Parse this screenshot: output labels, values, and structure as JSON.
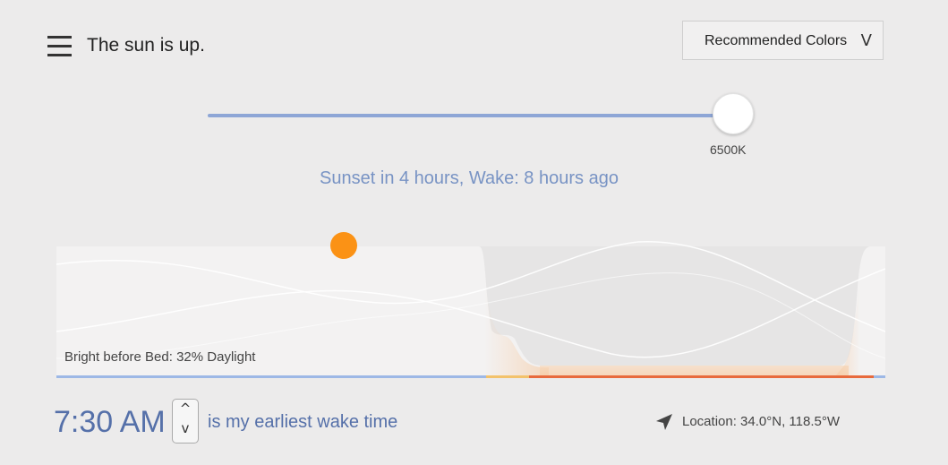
{
  "header": {
    "status": "The sun is up.",
    "menu_icon": "hamburger-menu-icon"
  },
  "color_dropdown": {
    "selected": "Recommended Colors",
    "chevron": "V"
  },
  "temperature_slider": {
    "value_label": "6500K",
    "position_fraction": 0.96,
    "accent": "#8ea6d6"
  },
  "info": {
    "text": "Sunset in 4 hours, Wake: 8 hours ago"
  },
  "chart_panel": {
    "bright_label": "Bright before Bed: 32% Daylight",
    "sun_color": "#fb9215",
    "timeline_colors": {
      "day": "#9db8e6",
      "transition": "#f3c26b",
      "night": "#e86a3d"
    }
  },
  "wake": {
    "time": "7:30 AM",
    "up_glyph": "^",
    "down_glyph": "v",
    "text": "is my earliest wake time"
  },
  "location": {
    "icon": "location-arrow-icon",
    "text": "Location: 34.0°N, 118.5°W"
  }
}
